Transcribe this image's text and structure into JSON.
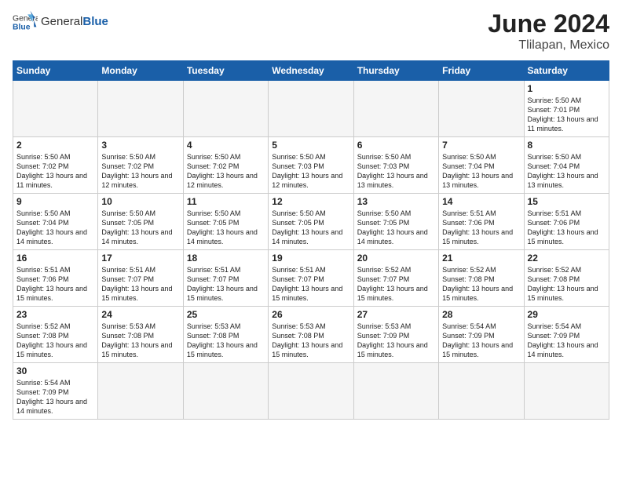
{
  "header": {
    "logo_general": "General",
    "logo_blue": "Blue",
    "month_title": "June 2024",
    "location": "Tlilapan, Mexico"
  },
  "weekdays": [
    "Sunday",
    "Monday",
    "Tuesday",
    "Wednesday",
    "Thursday",
    "Friday",
    "Saturday"
  ],
  "weeks": [
    [
      {
        "day": "",
        "empty": true
      },
      {
        "day": "",
        "empty": true
      },
      {
        "day": "",
        "empty": true
      },
      {
        "day": "",
        "empty": true
      },
      {
        "day": "",
        "empty": true
      },
      {
        "day": "",
        "empty": true
      },
      {
        "day": "1",
        "sunrise": "5:50 AM",
        "sunset": "7:01 PM",
        "daylight": "13 hours and 11 minutes."
      }
    ],
    [
      {
        "day": "2",
        "sunrise": "5:50 AM",
        "sunset": "7:02 PM",
        "daylight": "13 hours and 11 minutes."
      },
      {
        "day": "3",
        "sunrise": "5:50 AM",
        "sunset": "7:02 PM",
        "daylight": "13 hours and 12 minutes."
      },
      {
        "day": "4",
        "sunrise": "5:50 AM",
        "sunset": "7:02 PM",
        "daylight": "13 hours and 12 minutes."
      },
      {
        "day": "5",
        "sunrise": "5:50 AM",
        "sunset": "7:03 PM",
        "daylight": "13 hours and 12 minutes."
      },
      {
        "day": "6",
        "sunrise": "5:50 AM",
        "sunset": "7:03 PM",
        "daylight": "13 hours and 13 minutes."
      },
      {
        "day": "7",
        "sunrise": "5:50 AM",
        "sunset": "7:04 PM",
        "daylight": "13 hours and 13 minutes."
      },
      {
        "day": "8",
        "sunrise": "5:50 AM",
        "sunset": "7:04 PM",
        "daylight": "13 hours and 13 minutes."
      }
    ],
    [
      {
        "day": "9",
        "sunrise": "5:50 AM",
        "sunset": "7:04 PM",
        "daylight": "13 hours and 14 minutes."
      },
      {
        "day": "10",
        "sunrise": "5:50 AM",
        "sunset": "7:05 PM",
        "daylight": "13 hours and 14 minutes."
      },
      {
        "day": "11",
        "sunrise": "5:50 AM",
        "sunset": "7:05 PM",
        "daylight": "13 hours and 14 minutes."
      },
      {
        "day": "12",
        "sunrise": "5:50 AM",
        "sunset": "7:05 PM",
        "daylight": "13 hours and 14 minutes."
      },
      {
        "day": "13",
        "sunrise": "5:50 AM",
        "sunset": "7:05 PM",
        "daylight": "13 hours and 14 minutes."
      },
      {
        "day": "14",
        "sunrise": "5:51 AM",
        "sunset": "7:06 PM",
        "daylight": "13 hours and 15 minutes."
      },
      {
        "day": "15",
        "sunrise": "5:51 AM",
        "sunset": "7:06 PM",
        "daylight": "13 hours and 15 minutes."
      }
    ],
    [
      {
        "day": "16",
        "sunrise": "5:51 AM",
        "sunset": "7:06 PM",
        "daylight": "13 hours and 15 minutes."
      },
      {
        "day": "17",
        "sunrise": "5:51 AM",
        "sunset": "7:07 PM",
        "daylight": "13 hours and 15 minutes."
      },
      {
        "day": "18",
        "sunrise": "5:51 AM",
        "sunset": "7:07 PM",
        "daylight": "13 hours and 15 minutes."
      },
      {
        "day": "19",
        "sunrise": "5:51 AM",
        "sunset": "7:07 PM",
        "daylight": "13 hours and 15 minutes."
      },
      {
        "day": "20",
        "sunrise": "5:52 AM",
        "sunset": "7:07 PM",
        "daylight": "13 hours and 15 minutes."
      },
      {
        "day": "21",
        "sunrise": "5:52 AM",
        "sunset": "7:08 PM",
        "daylight": "13 hours and 15 minutes."
      },
      {
        "day": "22",
        "sunrise": "5:52 AM",
        "sunset": "7:08 PM",
        "daylight": "13 hours and 15 minutes."
      }
    ],
    [
      {
        "day": "23",
        "sunrise": "5:52 AM",
        "sunset": "7:08 PM",
        "daylight": "13 hours and 15 minutes."
      },
      {
        "day": "24",
        "sunrise": "5:53 AM",
        "sunset": "7:08 PM",
        "daylight": "13 hours and 15 minutes."
      },
      {
        "day": "25",
        "sunrise": "5:53 AM",
        "sunset": "7:08 PM",
        "daylight": "13 hours and 15 minutes."
      },
      {
        "day": "26",
        "sunrise": "5:53 AM",
        "sunset": "7:08 PM",
        "daylight": "13 hours and 15 minutes."
      },
      {
        "day": "27",
        "sunrise": "5:53 AM",
        "sunset": "7:09 PM",
        "daylight": "13 hours and 15 minutes."
      },
      {
        "day": "28",
        "sunrise": "5:54 AM",
        "sunset": "7:09 PM",
        "daylight": "13 hours and 15 minutes."
      },
      {
        "day": "29",
        "sunrise": "5:54 AM",
        "sunset": "7:09 PM",
        "daylight": "13 hours and 14 minutes."
      }
    ],
    [
      {
        "day": "30",
        "sunrise": "5:54 AM",
        "sunset": "7:09 PM",
        "daylight": "13 hours and 14 minutes."
      },
      {
        "day": "",
        "empty": true
      },
      {
        "day": "",
        "empty": true
      },
      {
        "day": "",
        "empty": true
      },
      {
        "day": "",
        "empty": true
      },
      {
        "day": "",
        "empty": true
      },
      {
        "day": "",
        "empty": true
      }
    ]
  ]
}
